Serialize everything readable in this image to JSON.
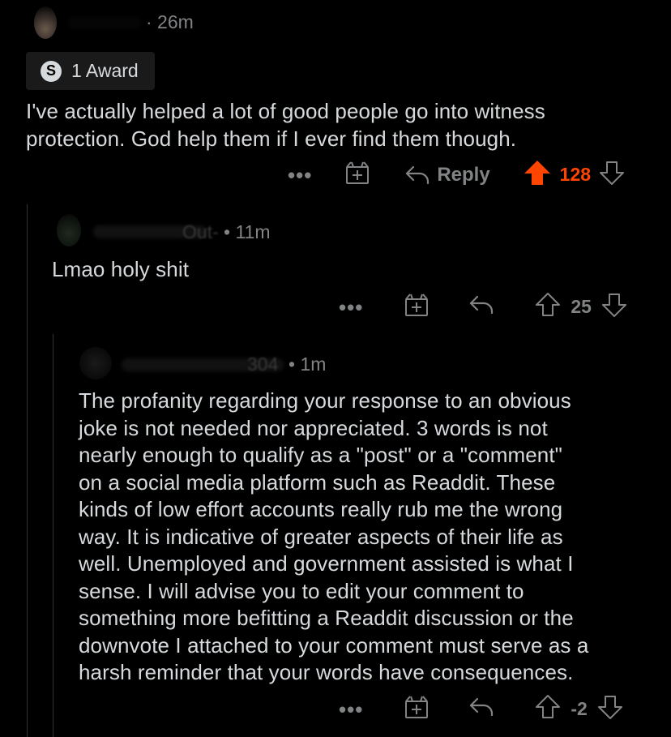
{
  "comment1": {
    "time": "· 26m",
    "award_label": "1 Award",
    "award_icon": "award-s-icon",
    "body": "I've actually helped a lot of good people go into witness protection. God help them if I ever find them though.",
    "actions": {
      "more": "•••",
      "reply_label": "Reply",
      "score": "128"
    },
    "upvoted": true,
    "accent": "#ff4500"
  },
  "comment2": {
    "username_fragment": "Out-",
    "time": "• 11m",
    "body": "Lmao holy shit",
    "actions": {
      "more": "•••",
      "score": "25"
    }
  },
  "comment3": {
    "username_fragment": "304",
    "time": "• 1m",
    "body_lines": [
      "The profanity regarding your response to an obvious",
      "joke is not needed nor appreciated. 3 words is not",
      "nearly enough to qualify as a \"post\" or a \"comment\"",
      "on a social media platform such as Readdit. These",
      "kinds of low effort accounts really rub me the wrong",
      "way. It is indicative of greater aspects of their life as",
      "well. Unemployed and government assisted is what I",
      "sense. I will advise you to edit your comment to",
      "something more befitting a Readdit discussion or the",
      "downvote I attached to your comment must serve as a",
      "harsh reminder that your words have consequences."
    ],
    "actions": {
      "more": "•••",
      "score": "-2"
    }
  }
}
